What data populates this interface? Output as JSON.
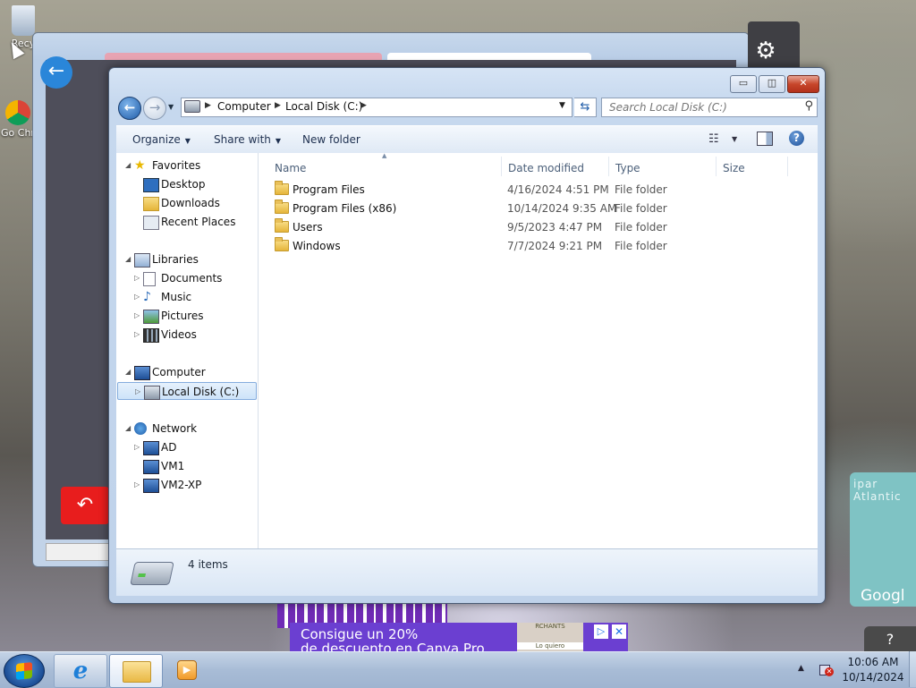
{
  "desktop": {
    "icons": [
      {
        "label": "Recy",
        "icon": "recycle-bin-icon"
      },
      {
        "label": "Go Chr",
        "icon": "chrome-icon"
      }
    ],
    "ad": {
      "line1": "Consigue un 20%",
      "line2": "de descuento en Canva Pro",
      "photo_caption": "RCHANTS",
      "photo_sub": "Lo quiero"
    },
    "map_text": "ipar Atlantic",
    "google_text": "Googl",
    "help_text": "?"
  },
  "window": {
    "min_label": "▭",
    "max_label": "◫",
    "close_label": "✕"
  },
  "address": {
    "crumbs": [
      "Computer",
      "Local Disk (C:)"
    ]
  },
  "search": {
    "placeholder": "Search Local Disk (C:)"
  },
  "toolbar": {
    "organize": "Organize",
    "share_with": "Share with",
    "new_folder": "New folder"
  },
  "nav": {
    "favorites": "Favorites",
    "desktop": "Desktop",
    "downloads": "Downloads",
    "recent_places": "Recent Places",
    "libraries": "Libraries",
    "documents": "Documents",
    "music": "Music",
    "pictures": "Pictures",
    "videos": "Videos",
    "computer": "Computer",
    "local_disk": "Local Disk (C:)",
    "network": "Network",
    "ad": "AD",
    "vm1": "VM1",
    "vm2": "VM2-XP"
  },
  "columns": {
    "name": "Name",
    "date": "Date modified",
    "type": "Type",
    "size": "Size"
  },
  "files": [
    {
      "name": "Program Files",
      "date": "4/16/2024 4:51 PM",
      "type": "File folder"
    },
    {
      "name": "Program Files (x86)",
      "date": "10/14/2024 9:35 AM",
      "type": "File folder"
    },
    {
      "name": "Users",
      "date": "9/5/2023 4:47 PM",
      "type": "File folder"
    },
    {
      "name": "Windows",
      "date": "7/7/2024 9:21 PM",
      "type": "File folder"
    }
  ],
  "status": {
    "count": "4 items"
  },
  "taskbar": {
    "time": "10:06 AM",
    "date": "10/14/2024"
  },
  "colors": {
    "selection_border": "#84acdd",
    "close_button": "#c7462b",
    "window_frame": "#c6d8ee"
  }
}
